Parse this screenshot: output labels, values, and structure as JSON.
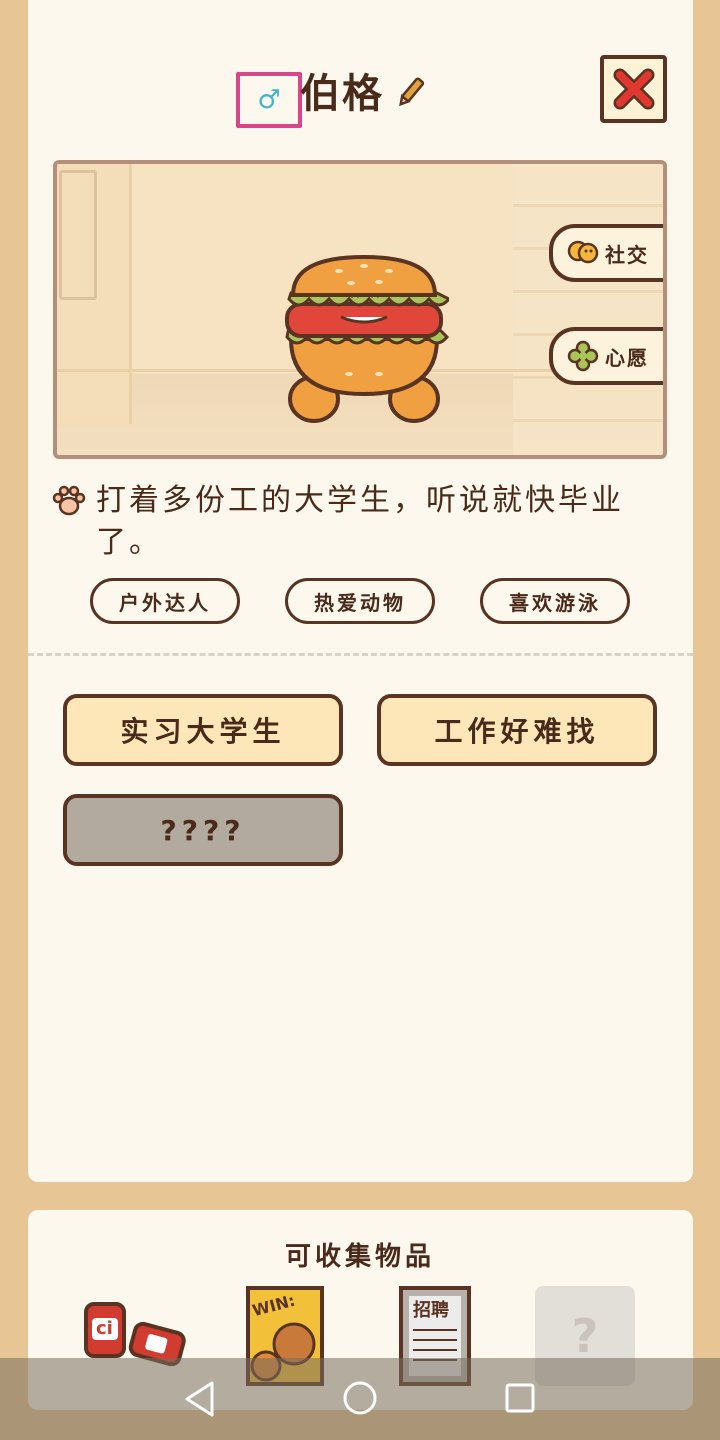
{
  "character": {
    "name": "伯格",
    "gender_icon": "male-icon",
    "gender_symbol": "♂",
    "description": "打着多份工的大学生，听说就快毕业了。"
  },
  "scene_buttons": {
    "social": "社交",
    "wish": "心愿"
  },
  "tags": [
    "户外达人",
    "热爱动物",
    "喜欢游泳"
  ],
  "traits": {
    "trait1": "实习大学生",
    "trait2": "工作好难找",
    "trait3": "????"
  },
  "collectibles": {
    "title": "可收集物品",
    "item_cans_label": "ci",
    "item_poster_label": "WIN:",
    "item_notice_label": "招聘",
    "item_locked_label": "?"
  },
  "colors": {
    "brown": "#5a3422",
    "cream": "#fdf8ee",
    "accent_red": "#e0382f",
    "gender_blue": "#3fb6c8",
    "highlight_pink": "#d8458a"
  }
}
